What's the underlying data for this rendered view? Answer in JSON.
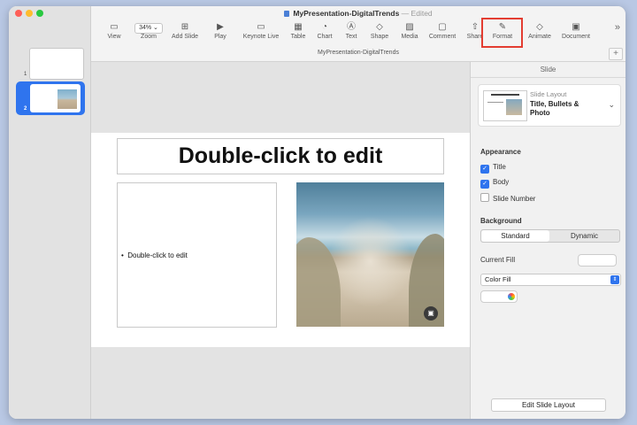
{
  "window": {
    "title": "MyPresentation-DigitalTrends",
    "separator": "—",
    "status": "Edited",
    "subtitle": "MyPresentation-DigitalTrends"
  },
  "toolbar": {
    "view": "View",
    "zoom_value": "34% ⌄",
    "zoom": "Zoom",
    "add_slide": "Add Slide",
    "play": "Play",
    "keynote_live": "Keynote Live",
    "table": "Table",
    "chart": "Chart",
    "text": "Text",
    "shape": "Shape",
    "media": "Media",
    "comment": "Comment",
    "share": "Share",
    "format": "Format",
    "animate": "Animate",
    "document": "Document"
  },
  "navigator": {
    "slides": [
      {
        "number": "1"
      },
      {
        "number": "2"
      }
    ]
  },
  "slide": {
    "title": "Double-click to edit",
    "bullet": "Double-click to edit"
  },
  "inspector": {
    "header": "Slide",
    "layout_label": "Slide Layout",
    "layout_value": "Title, Bullets & Photo",
    "appearance": "Appearance",
    "title_check": "Title",
    "body_check": "Body",
    "slide_number_check": "Slide Number",
    "background": "Background",
    "standard": "Standard",
    "dynamic": "Dynamic",
    "current_fill": "Current Fill",
    "fill_type": "Color Fill",
    "edit_layout": "Edit Slide Layout"
  }
}
